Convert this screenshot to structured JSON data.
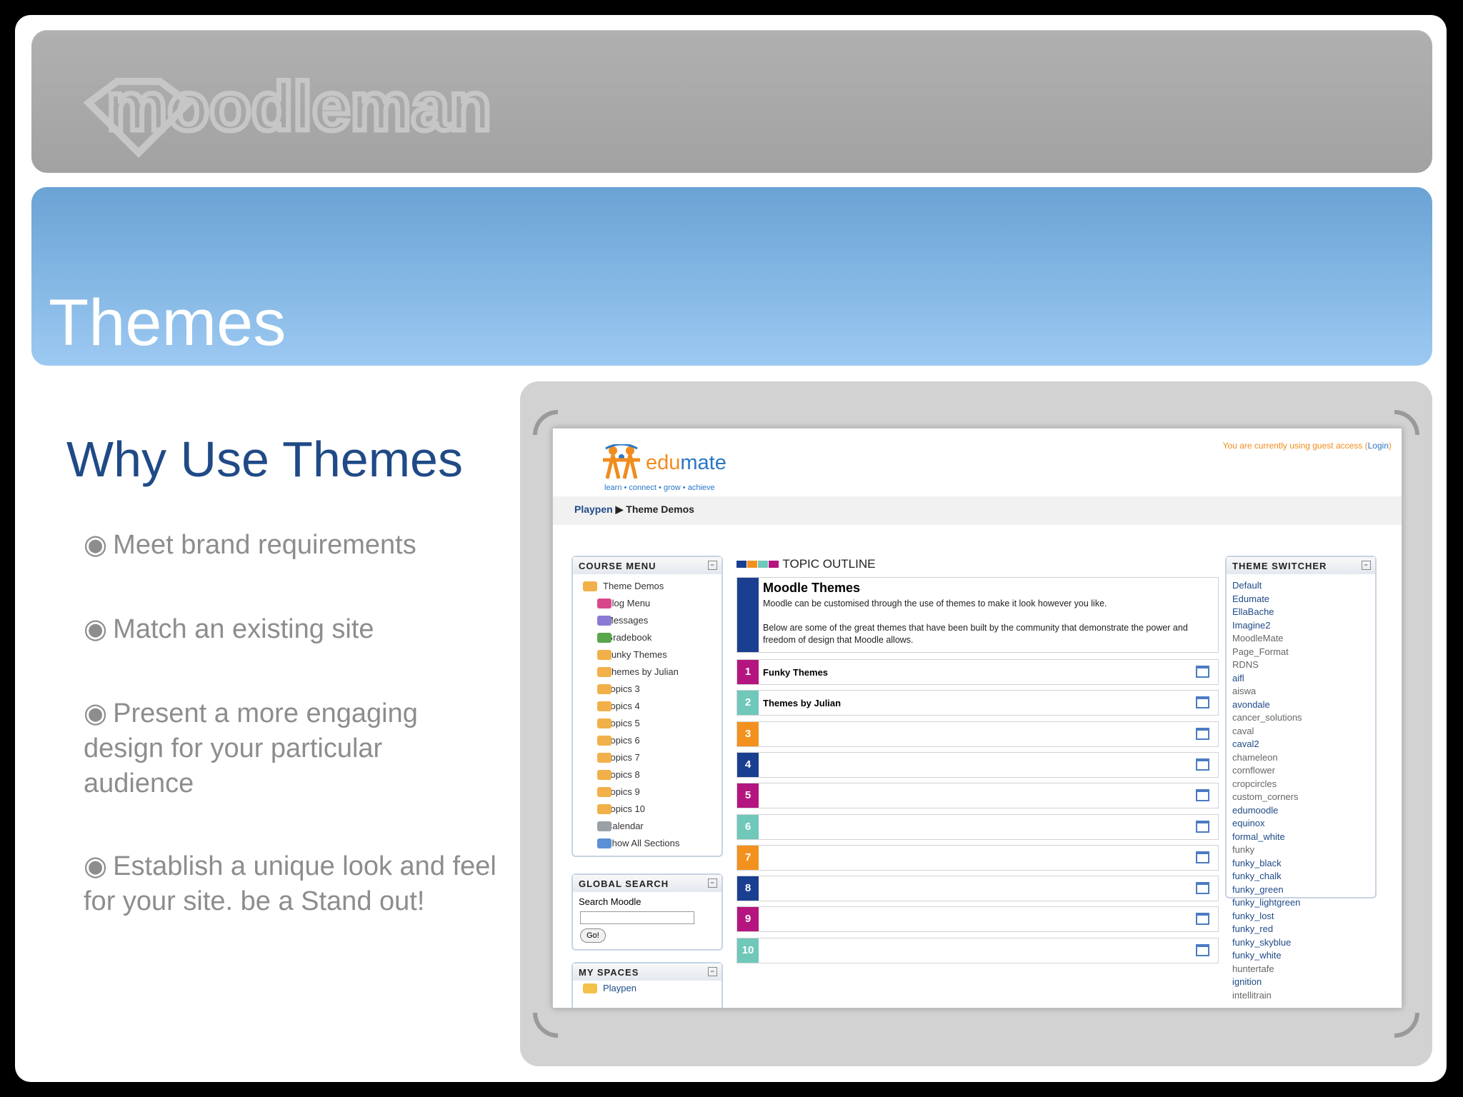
{
  "slide": {
    "brand_logo": "moodleman",
    "title": "Themes",
    "subtitle": "Why Use Themes",
    "bullets": [
      "Meet brand requirements",
      "Match an existing site",
      "Present a more engaging design for your particular audience",
      "Establish a unique look and feel for your site. be a Stand out!"
    ],
    "bullet_glyph": "◉"
  },
  "screenshot": {
    "site_name_a": "edu",
    "site_name_b": "mate",
    "tagline": "learn • connect • grow • achieve",
    "guest_text": "You are currently using guest access (",
    "login_label": "Login",
    "guest_close": ")",
    "breadcrumb": {
      "home": "Playpen",
      "separator": "▶",
      "current": "Theme Demos"
    },
    "course_menu": {
      "title": "COURSE MENU",
      "items": [
        {
          "label": "Theme Demos",
          "icon": "folder-open-icon"
        },
        {
          "label": "Blog Menu",
          "icon": "blog-icon"
        },
        {
          "label": "Messages",
          "icon": "messages-icon"
        },
        {
          "label": "Gradebook",
          "icon": "gradebook-icon"
        },
        {
          "label": "Funky Themes",
          "icon": "folder-icon"
        },
        {
          "label": "Themes by Julian",
          "icon": "folder-icon"
        },
        {
          "label": "Topics 3",
          "icon": "folder-icon"
        },
        {
          "label": "Topics 4",
          "icon": "folder-icon"
        },
        {
          "label": "Topics 5",
          "icon": "folder-icon"
        },
        {
          "label": "Topics 6",
          "icon": "folder-icon"
        },
        {
          "label": "Topics 7",
          "icon": "folder-icon"
        },
        {
          "label": "Topics 8",
          "icon": "folder-icon"
        },
        {
          "label": "Topics 9",
          "icon": "folder-icon"
        },
        {
          "label": "Topics 10",
          "icon": "folder-icon"
        },
        {
          "label": "Calendar",
          "icon": "calendar-icon"
        },
        {
          "label": "Show All Sections",
          "icon": "list-icon"
        }
      ]
    },
    "global_search": {
      "title": "GLOBAL SEARCH",
      "label": "Search Moodle",
      "button": "Go!"
    },
    "my_spaces": {
      "title": "MY SPACES",
      "item": "Playpen"
    },
    "topic_outline": {
      "title": "TOPIC OUTLINE",
      "summary_title": "Moodle Themes",
      "summary_p1": "Moodle can be customised through the use of themes to make it look however you like.",
      "summary_p2": "Below are some of the great themes that have been built by the community that demonstrate the power and freedom of design that Moodle allows.",
      "topics": [
        {
          "num": "1",
          "label": "Funky Themes",
          "color": "#b4157f"
        },
        {
          "num": "2",
          "label": "Themes by Julian",
          "color": "#6fc8b9"
        },
        {
          "num": "3",
          "label": "",
          "color": "#f3911f"
        },
        {
          "num": "4",
          "label": "",
          "color": "#1a3f91"
        },
        {
          "num": "5",
          "label": "",
          "color": "#b4157f"
        },
        {
          "num": "6",
          "label": "",
          "color": "#6fc8b9"
        },
        {
          "num": "7",
          "label": "",
          "color": "#f3911f"
        },
        {
          "num": "8",
          "label": "",
          "color": "#1a3f91"
        },
        {
          "num": "9",
          "label": "",
          "color": "#b4157f"
        },
        {
          "num": "10",
          "label": "",
          "color": "#6fc8b9"
        }
      ]
    },
    "theme_switcher": {
      "title": "THEME SWITCHER",
      "themes": [
        "Default",
        "Edumate",
        "EllaBache",
        "Imagine2",
        "MoodleMate",
        "Page_Format",
        "RDNS",
        "aifl",
        "aiswa",
        "avondale",
        "cancer_solutions",
        "caval",
        "caval2",
        "chameleon",
        "cornflower",
        "cropcircles",
        "custom_corners",
        "edumoodle",
        "equinox",
        "formal_white",
        "funky",
        "funky_black",
        "funky_chalk",
        "funky_green",
        "funky_lightgreen",
        "funky_lost",
        "funky_red",
        "funky_skyblue",
        "funky_white",
        "huntertafe",
        "ignition",
        "intellitrain"
      ]
    },
    "colors": {
      "magenta": "#b4157f",
      "teal": "#6fc8b9",
      "orange": "#f3911f",
      "navy": "#1a3f91",
      "link": "#1f4a86"
    }
  }
}
